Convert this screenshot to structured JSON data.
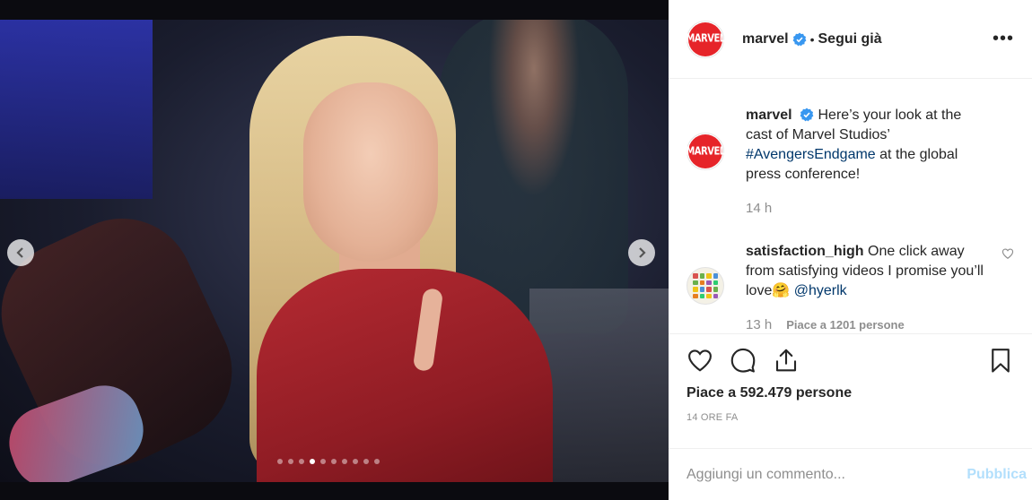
{
  "post": {
    "carousel_dots": 10,
    "active_dot": 3
  },
  "header": {
    "username": "marvel",
    "separator": "•",
    "follow_label": "Segui già",
    "more_label": "•••",
    "avatar_text": "MARVEL"
  },
  "caption": {
    "username": "marvel",
    "text_before": "Here’s your look at the cast of Marvel Studios’",
    "hashtag": "#AvengersEndgame",
    "text_after": "at the global press conference!",
    "time": "14 h"
  },
  "comments": [
    {
      "username": "satisfaction_high",
      "text": "One click away from satisfying videos I promise you’ll love",
      "emoji": "🤗",
      "mention": "@hyerlk",
      "time": "13 h",
      "likes": "Piace a 1201 persone"
    }
  ],
  "actions": {
    "likes_text": "Piace a 592.479 persone",
    "timestamp": "14 ORE FA"
  },
  "composer": {
    "placeholder": "Aggiungi un commento...",
    "publish_label": "Pubblica"
  },
  "colors": {
    "verified": "#3897f0",
    "marvel_red": "#e62429",
    "link": "#00376b",
    "publish_disabled": "#b2dffc"
  },
  "icons": [
    "chevron-left-icon",
    "chevron-right-icon",
    "verified-icon",
    "heart-icon",
    "comment-icon",
    "share-icon",
    "bookmark-icon"
  ]
}
